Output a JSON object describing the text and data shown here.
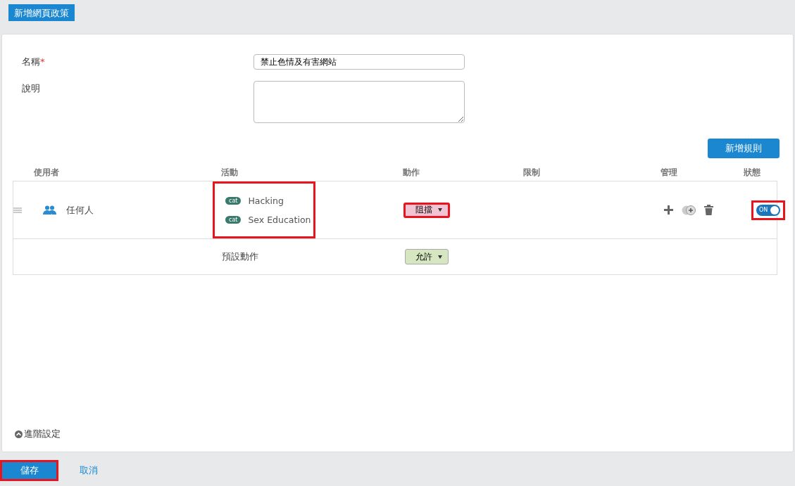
{
  "header": {
    "tab": "新增網頁政策"
  },
  "form": {
    "name_label": "名稱",
    "required_mark": "*",
    "name_value": "禁止色情及有害網站",
    "description_label": "說明"
  },
  "add_rule_button": "新增規則",
  "table": {
    "columns": [
      "使用者",
      "活動",
      "動作",
      "限制",
      "管理",
      "狀態"
    ],
    "rows": [
      {
        "user": "任何人",
        "activities": [
          {
            "tag": "cat",
            "label": "Hacking"
          },
          {
            "tag": "cat",
            "label": "Sex Education"
          }
        ],
        "activities_highlighted": true,
        "action": {
          "label": "阻擋",
          "kind": "block",
          "highlighted": true
        },
        "status": {
          "label": "ON",
          "on": true,
          "highlighted": true
        }
      }
    ],
    "default_row": {
      "label": "預設動作",
      "action": {
        "label": "允許",
        "kind": "allow",
        "highlighted": false
      }
    }
  },
  "advanced": "進階設定",
  "footer": {
    "save": "儲存",
    "save_highlighted": true,
    "cancel": "取消"
  }
}
